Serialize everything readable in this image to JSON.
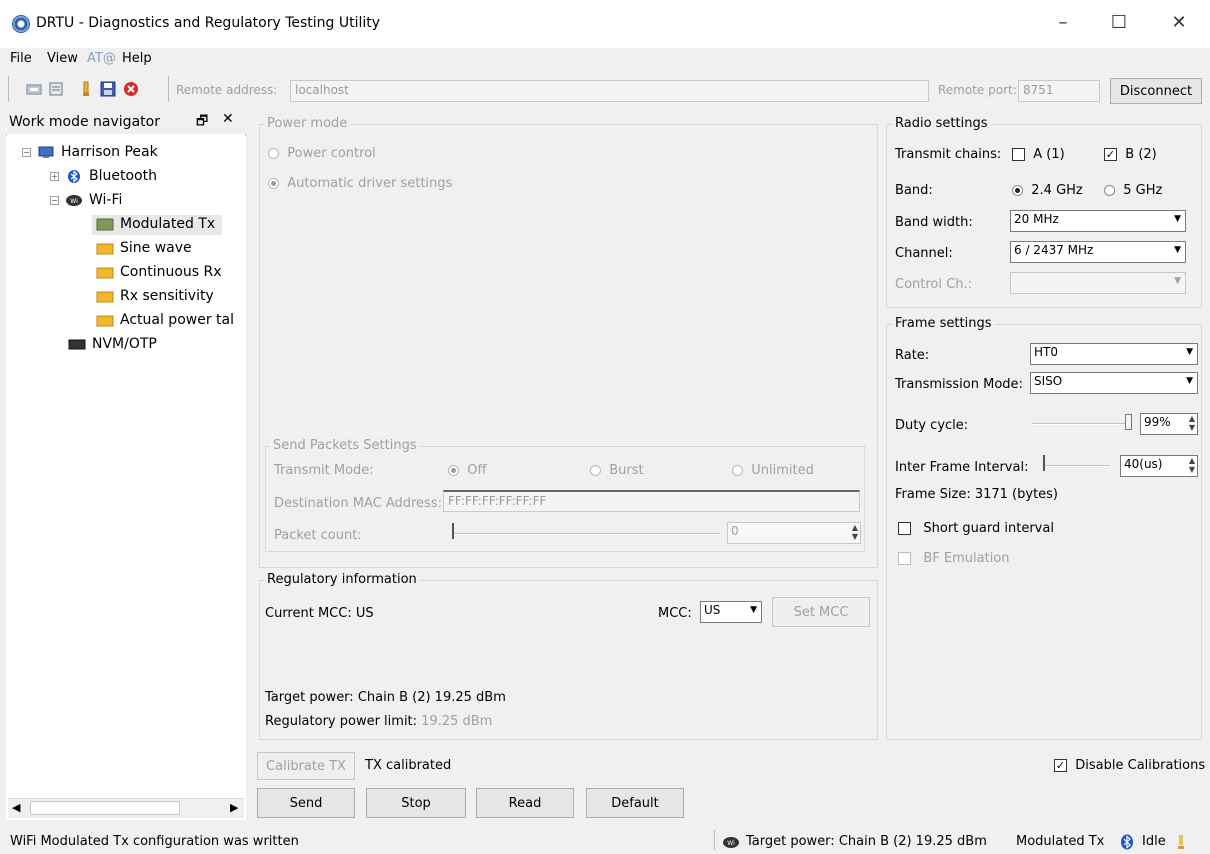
{
  "window": {
    "title": "DRTU - Diagnostics and Regulatory Testing Utility"
  },
  "menu": [
    "File",
    "View",
    "AT@",
    "Help"
  ],
  "toolbar": {
    "remote_address_label": "Remote address:",
    "remote_address_value": "localhost",
    "remote_port_label": "Remote port:",
    "remote_port_value": "8751",
    "disconnect_label": "Disconnect"
  },
  "navigator": {
    "title": "Work mode navigator",
    "root": "Harrison Peak",
    "bluetooth": "Bluetooth",
    "wifi": "Wi-Fi",
    "wifi_items": [
      "Modulated Tx",
      "Sine wave",
      "Continuous Rx",
      "Rx sensitivity",
      "Actual power tal"
    ],
    "nvm": "NVM/OTP"
  },
  "power_mode": {
    "title": "Power mode",
    "power_control": "Power control",
    "auto_driver": "Automatic driver settings"
  },
  "send_packets": {
    "title": "Send Packets Settings",
    "transmit_mode_label": "Transmit Mode:",
    "off": "Off",
    "burst": "Burst",
    "unlimited": "Unlimited",
    "dest_mac_label": "Destination MAC Address:",
    "dest_mac_value": "FF:FF:FF:FF:FF:FF",
    "packet_count_label": "Packet count:",
    "packet_count_value": "0"
  },
  "regulatory": {
    "title": "Regulatory information",
    "current_mcc": "Current MCC:  US",
    "mcc_label": "MCC:",
    "mcc_value": "US",
    "set_mcc": "Set MCC",
    "target_power": "Target power: Chain B (2) 19.25 dBm",
    "reg_limit_label": "Regulatory power limit:",
    "reg_limit_value": "19.25 dBm"
  },
  "radio": {
    "title": "Radio settings",
    "transmit_chains_label": "Transmit chains:",
    "chain_a": "A (1)",
    "chain_b": "B (2)",
    "band_label": "Band:",
    "band_24": "2.4 GHz",
    "band_5": "5 GHz",
    "bandwidth_label": "Band width:",
    "bandwidth_value": "20 MHz",
    "channel_label": "Channel:",
    "channel_value": "6 / 2437 MHz",
    "control_ch_label": "Control Ch.:"
  },
  "frame": {
    "title": "Frame settings",
    "rate_label": "Rate:",
    "rate_value": "HT0",
    "tx_mode_label": "Transmission Mode:",
    "tx_mode_value": "SISO",
    "duty_label": "Duty cycle:",
    "duty_value": "99%",
    "ifi_label": "Inter Frame Interval:",
    "ifi_value": "40(us)",
    "frame_size": "Frame Size:  3171  (bytes)",
    "short_guard": "Short guard interval",
    "bf_emulation": "BF Emulation"
  },
  "bottom": {
    "calibrate_tx": "Calibrate TX",
    "tx_calibrated": "TX calibrated",
    "disable_calibrations": "Disable Calibrations",
    "send": "Send",
    "stop": "Stop",
    "read": "Read",
    "default": "Default"
  },
  "status": {
    "message": "WiFi Modulated Tx configuration was written",
    "target_power": "Target power: Chain B (2) 19.25 dBm",
    "mode": "Modulated Tx",
    "state": "Idle"
  }
}
